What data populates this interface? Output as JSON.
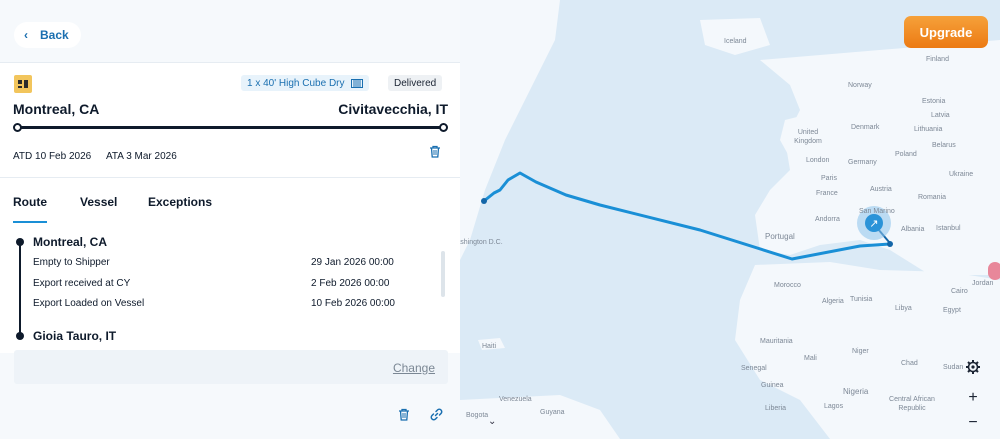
{
  "nav": {
    "back_label": "Back"
  },
  "shipment": {
    "container": "1 x 40' High Cube Dry",
    "status": "Delivered",
    "origin": "Montreal, CA",
    "destination": "Civitavecchia, IT",
    "atd": "ATD 10 Feb 2026",
    "ata": "ATA 3 Mar 2026"
  },
  "tabs": [
    "Route",
    "Vessel",
    "Exceptions"
  ],
  "active_tab": "Route",
  "timeline": {
    "stops": [
      {
        "name": "Montreal, CA",
        "events": [
          {
            "label": "Empty to Shipper",
            "time": "29 Jan 2026 00:00"
          },
          {
            "label": "Export received at CY",
            "time": "2 Feb 2026 00:00"
          },
          {
            "label": "Export Loaded on Vessel",
            "time": "10 Feb 2026 00:00"
          }
        ]
      },
      {
        "name": "Gioia Tauro, IT",
        "events": []
      }
    ]
  },
  "change_label": "Change",
  "upgrade_label": "Upgrade",
  "map": {
    "labels": [
      "Iceland",
      "Finland",
      "Norway",
      "Estonia",
      "Latvia",
      "Lithuania",
      "Denmark",
      "United Kingdom",
      "Belarus",
      "London",
      "Germany",
      "Poland",
      "Ukraine",
      "Paris",
      "France",
      "Austria",
      "Romania",
      "Andorra",
      "San Marino",
      "Albania",
      "Istanbul",
      "Portugal",
      "Tunisia",
      "Morocco",
      "Algeria",
      "Libya",
      "Cairo",
      "Egypt",
      "Jordan",
      "Mauritania",
      "Mali",
      "Niger",
      "Chad",
      "Sudan",
      "Senegal",
      "Guinea",
      "Nigeria",
      "Liberia",
      "Lagos",
      "Central African Republic",
      "Haiti",
      "Venezuela",
      "Guyana",
      "Bogota",
      "Washington D.C."
    ]
  },
  "colors": {
    "accent": "#1a8fd6",
    "route": "#1a8fd6",
    "upgrade": "#ef8520",
    "dark": "#0e1a2b"
  },
  "icons": [
    "chevron-left-icon",
    "carrier-logo",
    "container-icon",
    "trash-icon",
    "link-icon",
    "vessel-icon",
    "settings-icon",
    "zoom-in-icon",
    "zoom-out-icon",
    "chevron-down-icon"
  ]
}
